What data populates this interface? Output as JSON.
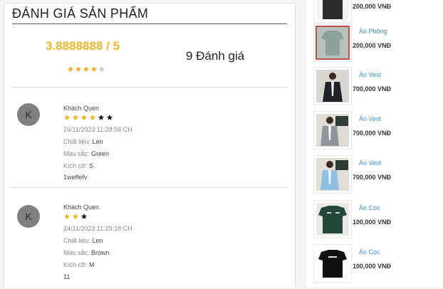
{
  "reviews_section": {
    "title": "ĐÁNH GIÁ SẢN PHẨM",
    "average": "3.8888888 / 5",
    "average_stars": [
      1,
      1,
      1,
      1,
      0
    ],
    "count_text": "9 Đánh giá"
  },
  "reviews": [
    {
      "avatar": "K",
      "name": "Khách Quen",
      "stars": [
        1,
        1,
        1,
        1,
        0,
        0
      ],
      "date": "24/11/2023 11:28:56 CH",
      "material_label": "Chất liệu:",
      "material": "Len",
      "color_label": "Màu sắc:",
      "color": "Green",
      "size_label": "Kích cỡ:",
      "size": "S",
      "comment": "1weffefv"
    },
    {
      "avatar": "K",
      "name": "Khách Quen",
      "stars": [
        1,
        1,
        0
      ],
      "date": "24/11/2023 11:29:18 CH",
      "material_label": "Chất liệu:",
      "material": "Len",
      "color_label": "Màu sắc:",
      "color": "Brown",
      "size_label": "Kích cỡ:",
      "size": "M",
      "comment": "11"
    }
  ],
  "related_products": [
    {
      "name": "",
      "price": "200,000 VNĐ",
      "thumb": "dark-shirt-icon"
    },
    {
      "name": "Áo Phông",
      "price": "200,000 VNĐ",
      "thumb": "tshirt-icon"
    },
    {
      "name": "Áo Vest",
      "price": "700,000 VNĐ",
      "thumb": "vest-dark-icon"
    },
    {
      "name": "Áo Vest",
      "price": "700,000 VNĐ",
      "thumb": "vest-gray-icon"
    },
    {
      "name": "Áo Vest",
      "price": "700,000 VNĐ",
      "thumb": "vest-blue-icon"
    },
    {
      "name": "Áo Cọc",
      "price": "100,000 VNĐ",
      "thumb": "green-tee-icon"
    },
    {
      "name": "Áo Cọc",
      "price": "100,000 VNĐ",
      "thumb": "black-tee-icon"
    }
  ],
  "colors": {
    "star_filled": "#f0b428",
    "star_empty_summary": "#cccccc",
    "star_empty_review": "#222222",
    "link": "#3b8fd8"
  }
}
